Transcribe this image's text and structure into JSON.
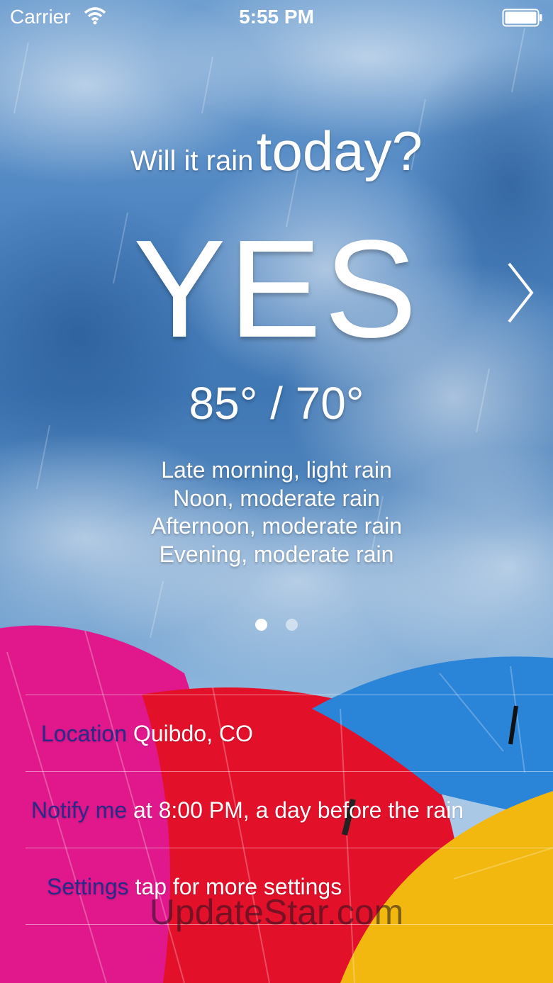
{
  "status_bar": {
    "carrier": "Carrier",
    "time": "5:55 PM",
    "wifi_icon": "wifi-icon",
    "battery_icon": "battery-icon"
  },
  "headline": {
    "prefix": "Will it rain",
    "emphasis": "today?"
  },
  "answer": "YES",
  "temperature": "85° / 70°",
  "forecast": [
    "Late morning, light rain",
    "Noon, moderate rain",
    "Afternoon, moderate rain",
    "Evening, moderate rain"
  ],
  "page_indicator": {
    "current": 1,
    "total": 2
  },
  "settings_rows": [
    {
      "label": "Location",
      "value": "Quibdo, CO"
    },
    {
      "label": "Notify me",
      "value": "at 8:00 PM, a day before the rain"
    },
    {
      "label": "Settings",
      "value": "tap for more settings"
    }
  ],
  "watermark": "UpdateStar.com",
  "colors": {
    "sky": "#4f86c2",
    "label_text": "#2a2a8a",
    "umbrella_pink": "#e0188c",
    "umbrella_red": "#e3102a",
    "umbrella_blue": "#2a84d8",
    "umbrella_yellow": "#f2b80f"
  }
}
